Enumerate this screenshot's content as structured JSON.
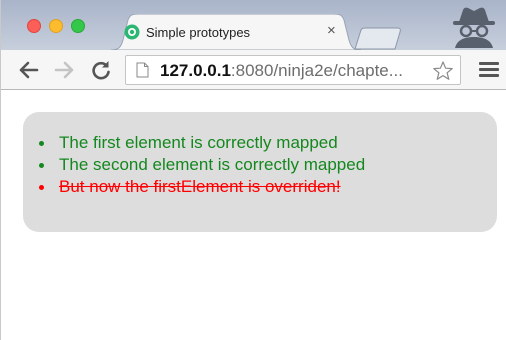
{
  "tab": {
    "title": "Simple prototypes",
    "close_glyph": "×",
    "favicon": "ninja-favicon-icon"
  },
  "address_bar": {
    "host": "127.0.0.1",
    "path": ":8080/ninja2e/chapte..."
  },
  "content": {
    "items": [
      {
        "text": "The first element is correctly mapped",
        "status": "ok"
      },
      {
        "text": "The second element is correctly mapped",
        "status": "ok"
      },
      {
        "text": "But now the firstElement is overriden!",
        "status": "error"
      }
    ]
  },
  "colors": {
    "ok": "#14881e",
    "error": "#ff0000",
    "box_bg": "#dddddd"
  }
}
